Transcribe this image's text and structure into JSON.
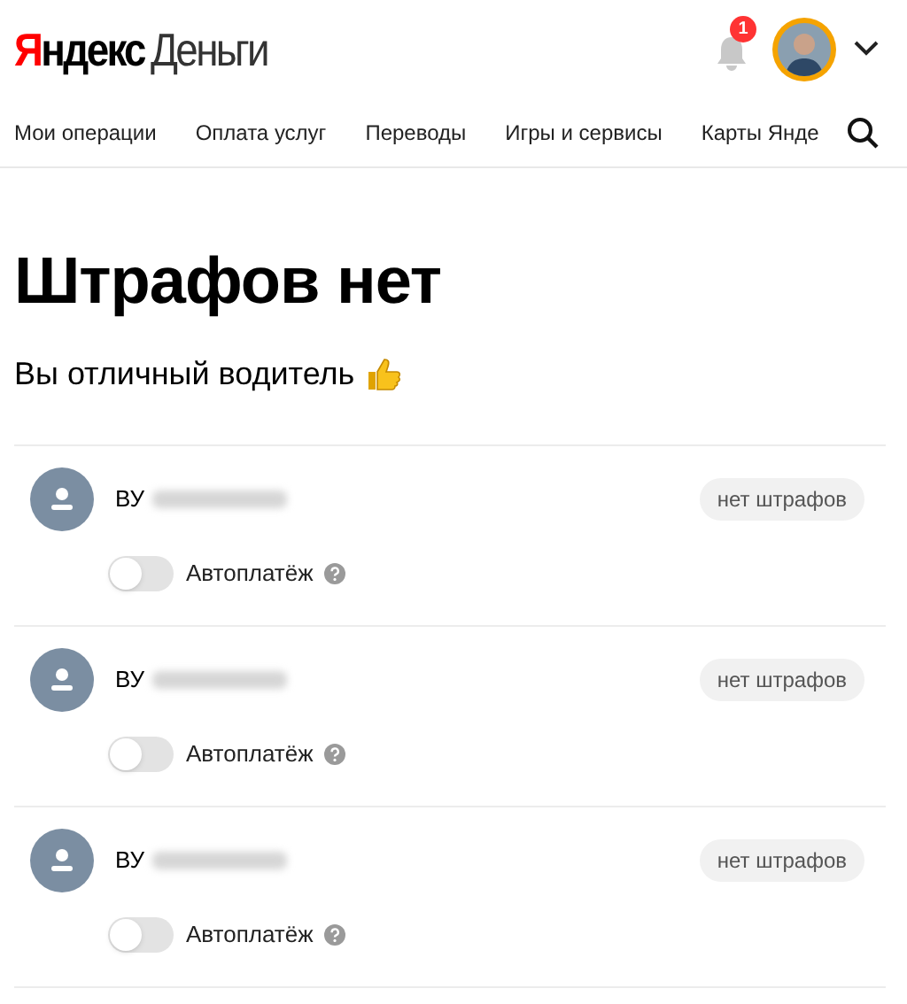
{
  "header": {
    "logo_brand": "Яндекс",
    "logo_product": "Деньги",
    "notifications": {
      "count": "1"
    }
  },
  "nav": {
    "items": [
      {
        "label": "Мои операции"
      },
      {
        "label": "Оплата услуг"
      },
      {
        "label": "Переводы"
      },
      {
        "label": "Игры и сервисы"
      },
      {
        "label": "Карты Янде"
      }
    ]
  },
  "title": "Штрафов нет",
  "subtitle": "Вы отличный водитель",
  "documents": [
    {
      "type": "ВУ",
      "status": "нет штрафов",
      "autopay": {
        "label": "Автоплатёж",
        "on": false
      }
    },
    {
      "type": "ВУ",
      "status": "нет штрафов",
      "autopay": {
        "label": "Автоплатёж",
        "on": false
      }
    },
    {
      "type": "ВУ",
      "status": "нет штрафов",
      "autopay": {
        "label": "Автоплатёж",
        "on": false
      }
    }
  ]
}
